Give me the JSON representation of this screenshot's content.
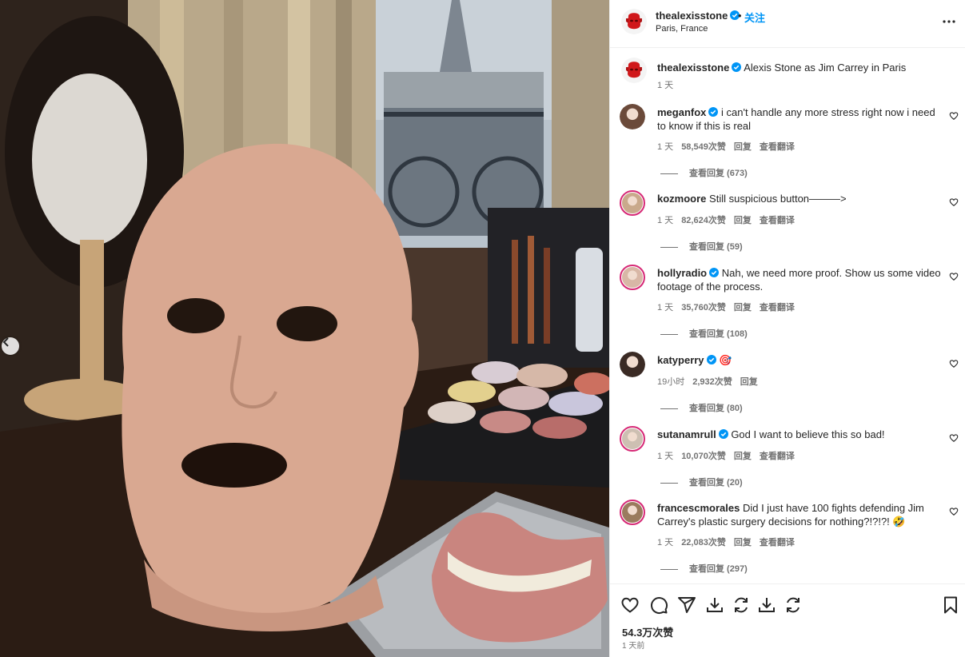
{
  "post": {
    "username": "thealexisstone",
    "follow_label": "关注",
    "separator": "•",
    "location": "Paris, France",
    "caption_text": "Alexis Stone as Jim Carrey in Paris",
    "caption_time": "1 天",
    "likes": "54.3万次赞",
    "posted_ago": "1 天前"
  },
  "labels": {
    "reply": "回复",
    "translate": "查看翻译"
  },
  "comments": [
    {
      "username": "meganfox",
      "verified": true,
      "text": "i can't handle any more stress right now i need to know if this is real",
      "time": "1 天",
      "likes": "58,549次赞",
      "translate": true,
      "replies": "查看回复 (673)"
    },
    {
      "username": "kozmoore",
      "verified": false,
      "text": "Still suspicious button———>",
      "time": "1 天",
      "likes": "82,624次赞",
      "translate": true,
      "replies": "查看回复 (59)"
    },
    {
      "username": "hollyradio",
      "verified": true,
      "text": "Nah, we need more proof. Show us some video footage of the process.",
      "time": "1 天",
      "likes": "35,760次赞",
      "translate": true,
      "replies": "查看回复 (108)"
    },
    {
      "username": "katyperry",
      "verified": true,
      "text": "🎯",
      "time": "19小时",
      "likes": "2,932次赞",
      "translate": false,
      "replies": "查看回复 (80)"
    },
    {
      "username": "sutanamrull",
      "verified": true,
      "text": "God I want to believe this so bad!",
      "time": "1 天",
      "likes": "10,070次赞",
      "translate": true,
      "replies": "查看回复 (20)"
    },
    {
      "username": "francescmorales",
      "verified": false,
      "text": "Did I just have 100 fights defending Jim Carrey's plastic surgery decisions for nothing?!?!?! 🤣",
      "time": "1 天",
      "likes": "22,083次赞",
      "translate": true,
      "replies": "查看回复 (297)"
    }
  ],
  "colors": {
    "link_blue": "#0095f6",
    "verified_blue": "#0095f6",
    "muted_text": "#737373",
    "story_ring": "#d62976"
  }
}
